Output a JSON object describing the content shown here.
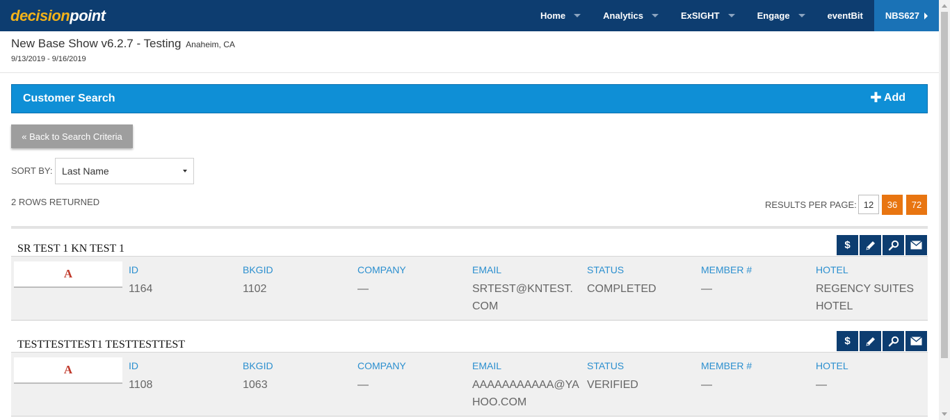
{
  "nav": {
    "logo_part1": "decision",
    "logo_part2": "point",
    "items": [
      {
        "label": "Home",
        "has_caret": true
      },
      {
        "label": "Analytics",
        "has_caret": true
      },
      {
        "label": "ExSIGHT",
        "has_caret": true
      },
      {
        "label": "Engage",
        "has_caret": true
      },
      {
        "label": "eventBit",
        "has_caret": false
      }
    ],
    "account": "NBS627"
  },
  "show": {
    "title": "New Base Show v6.2.7 - Testing",
    "location": "Anaheim, CA",
    "dates": "9/13/2019 - 9/16/2019"
  },
  "panel": {
    "title": "Customer Search",
    "add_label": "Add",
    "add_icon": "plus-icon"
  },
  "back_button": "« Back to Search Criteria",
  "sort": {
    "label": "SORT BY:",
    "value": "Last Name"
  },
  "rows_returned": "2 ROWS RETURNED",
  "results_per_page": {
    "label": "RESULTS PER PAGE:",
    "options": [
      "12",
      "36",
      "72"
    ]
  },
  "columns": [
    "ID",
    "BKGID",
    "COMPANY",
    "EMAIL",
    "STATUS",
    "MEMBER #",
    "HOTEL"
  ],
  "records": [
    {
      "name": "SR TEST 1 KN TEST 1",
      "thumb": "A",
      "values": [
        "1164",
        "1102",
        "—",
        "SRTEST@KNTEST.COM",
        "COMPLETED",
        "—",
        "REGENCY SUITES HOTEL"
      ]
    },
    {
      "name": "TESTTESTTEST1 TESTTESTTEST",
      "thumb": "A",
      "values": [
        "1108",
        "1063",
        "—",
        "AAAAAAAAAAA@YAHOO.COM",
        "VERIFIED",
        "—",
        "—"
      ]
    }
  ],
  "action_icons": [
    "dollar-icon",
    "pencil-icon",
    "search-icon",
    "envelope-icon"
  ],
  "colors": {
    "nav_bg": "#0d3d70",
    "panel_bg": "#0f8fd6",
    "accent_orange": "#e87511",
    "label_blue": "#2b8fcf"
  }
}
